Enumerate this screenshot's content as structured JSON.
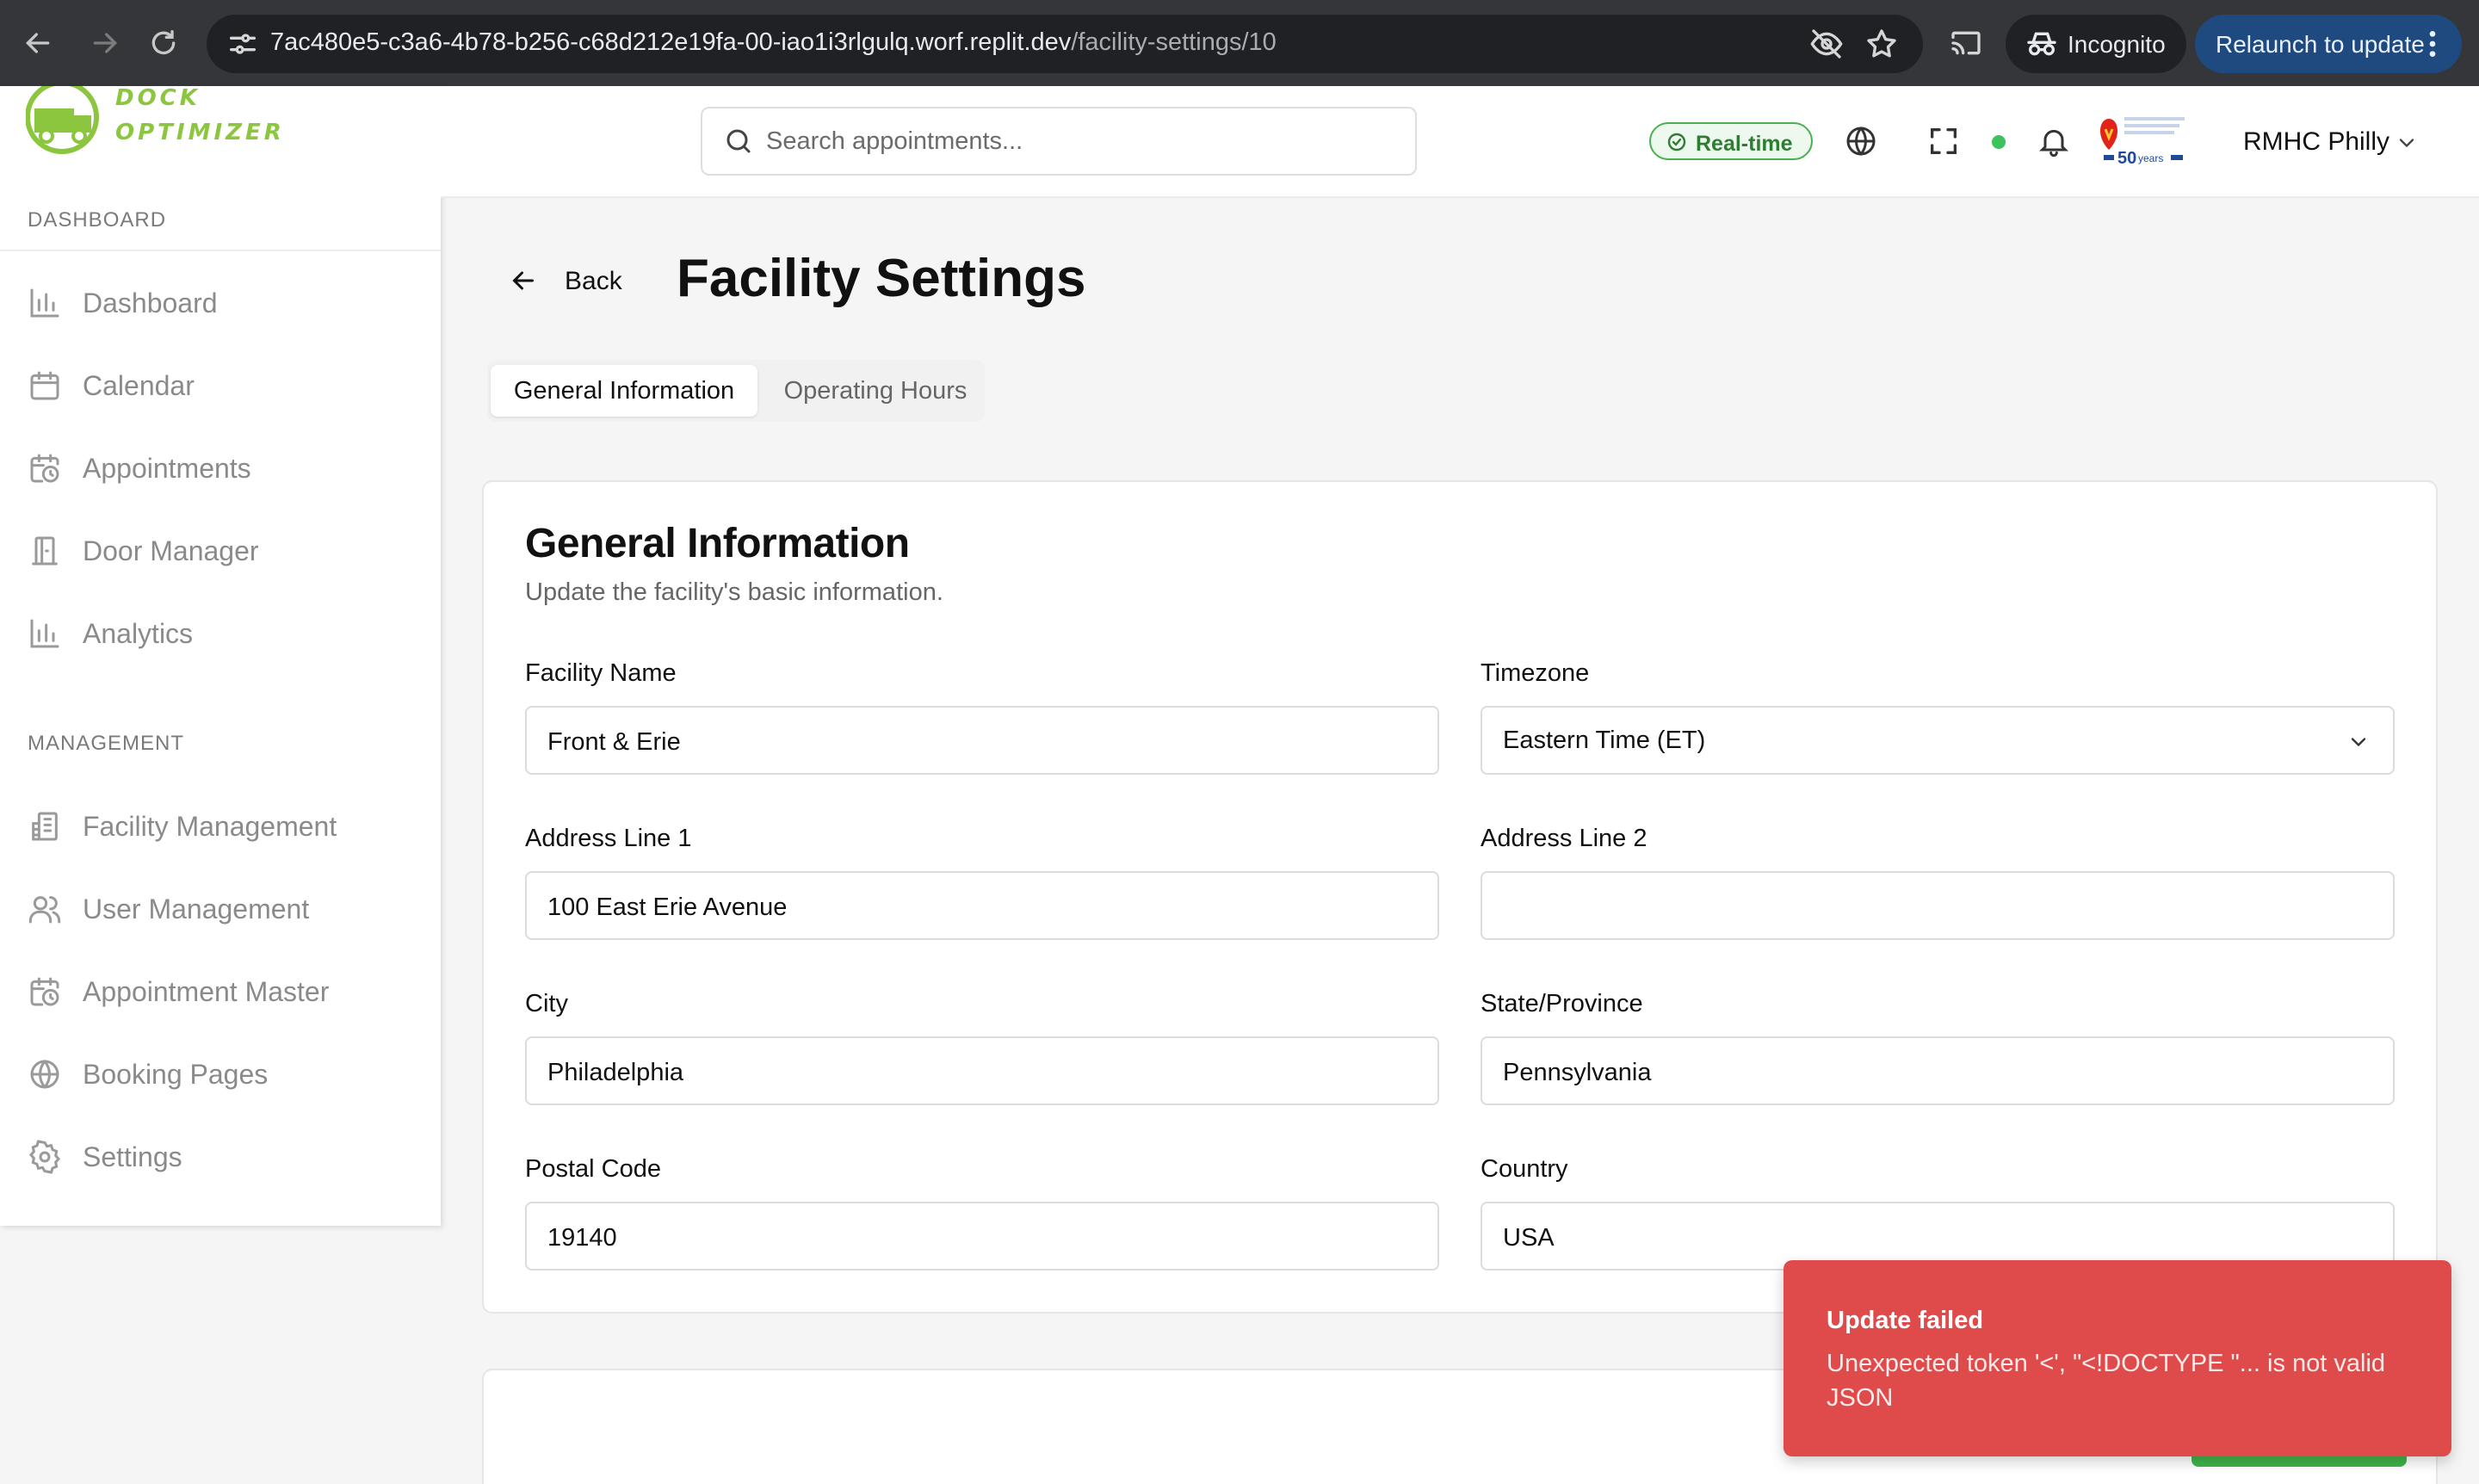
{
  "browser": {
    "url_host": "7ac480e5-c3a6-4b78-b256-c68d212e19fa-00-iao1i3rlgulq.worf.replit.dev",
    "url_path": "/facility-settings/10",
    "incognito_label": "Incognito",
    "relaunch_label": "Relaunch to update"
  },
  "app": {
    "logo_text_line1": "DOCK",
    "logo_text_line2": "OPTIMIZER"
  },
  "sidebar": {
    "dashboard_section": "DASHBOARD",
    "management_section": "MANAGEMENT",
    "items": [
      {
        "label": "Dashboard",
        "icon": "bar-chart-icon"
      },
      {
        "label": "Calendar",
        "icon": "calendar-icon"
      },
      {
        "label": "Appointments",
        "icon": "calendar-clock-icon"
      },
      {
        "label": "Door Manager",
        "icon": "door-icon"
      },
      {
        "label": "Analytics",
        "icon": "bar-chart-icon"
      },
      {
        "label": "Facility Management",
        "icon": "building-icon"
      },
      {
        "label": "User Management",
        "icon": "users-icon"
      },
      {
        "label": "Appointment Master",
        "icon": "calendar-clock-icon"
      },
      {
        "label": "Booking Pages",
        "icon": "globe-icon"
      },
      {
        "label": "Settings",
        "icon": "gear-icon"
      }
    ]
  },
  "header": {
    "search_placeholder": "Search appointments...",
    "realtime_label": "Real-time",
    "org_name": "RMHC Philly",
    "status_color": "#3cc35c"
  },
  "page": {
    "back_label": "Back",
    "title": "Facility Settings",
    "tabs": [
      {
        "label": "General Information",
        "active": true
      },
      {
        "label": "Operating Hours",
        "active": false
      }
    ]
  },
  "general": {
    "title": "General Information",
    "subtitle": "Update the facility's basic information.",
    "fields": {
      "facility_name": {
        "label": "Facility Name",
        "value": "Front & Erie"
      },
      "timezone": {
        "label": "Timezone",
        "value": "Eastern Time (ET)"
      },
      "address1": {
        "label": "Address Line 1",
        "value": "100 East Erie Avenue"
      },
      "address2": {
        "label": "Address Line 2",
        "value": ""
      },
      "city": {
        "label": "City",
        "value": "Philadelphia"
      },
      "state": {
        "label": "State/Province",
        "value": "Pennsylvania"
      },
      "postal": {
        "label": "Postal Code",
        "value": "19140"
      },
      "country": {
        "label": "Country",
        "value": "USA"
      }
    }
  },
  "toast": {
    "title": "Update failed",
    "message": "Unexpected token '<', \"<!DOCTYPE \"... is not valid JSON",
    "color": "#df4b4b"
  }
}
